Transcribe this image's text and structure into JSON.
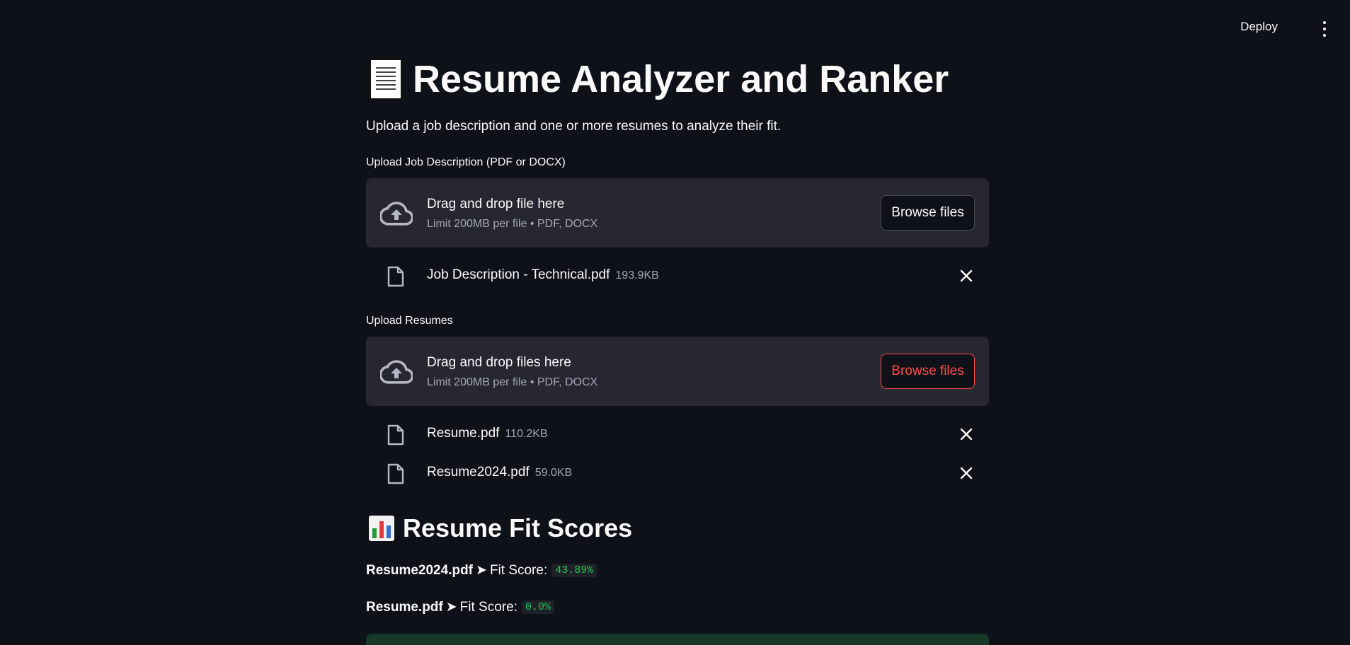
{
  "toolbar": {
    "deploy_label": "Deploy"
  },
  "title": "Resume Analyzer and Ranker",
  "subtitle": "Upload a job description and one or more resumes to analyze their fit.",
  "job_uploader": {
    "label": "Upload Job Description (PDF or DOCX)",
    "drop_text": "Drag and drop file here",
    "limit_text": "Limit 200MB per file • PDF, DOCX",
    "browse_label": "Browse files",
    "files": [
      {
        "name": "Job Description - Technical.pdf",
        "size": "193.9KB"
      }
    ]
  },
  "resume_uploader": {
    "label": "Upload Resumes",
    "drop_text": "Drag and drop files here",
    "limit_text": "Limit 200MB per file • PDF, DOCX",
    "browse_label": "Browse files",
    "files": [
      {
        "name": "Resume.pdf",
        "size": "110.2KB"
      },
      {
        "name": "Resume2024.pdf",
        "size": "59.0KB"
      }
    ]
  },
  "results": {
    "title": "Resume Fit Scores",
    "score_label": "Fit Score:",
    "arrow": "➤",
    "scores": [
      {
        "file": "Resume2024.pdf",
        "score": "43.89%"
      },
      {
        "file": "Resume.pdf",
        "score": "0.0%"
      }
    ]
  },
  "icons": {
    "title_icon": "page-facing-up-icon",
    "results_icon": "bar-chart-icon",
    "upload_icon": "cloud-upload-icon",
    "file_icon": "file-icon",
    "remove_icon": "close-icon",
    "menu_icon": "more-vertical-icon"
  },
  "colors": {
    "background": "#0e1117",
    "panel": "#262730",
    "accent": "#ff4b4b",
    "score_text": "#21c354",
    "success_bg": "#173928"
  }
}
